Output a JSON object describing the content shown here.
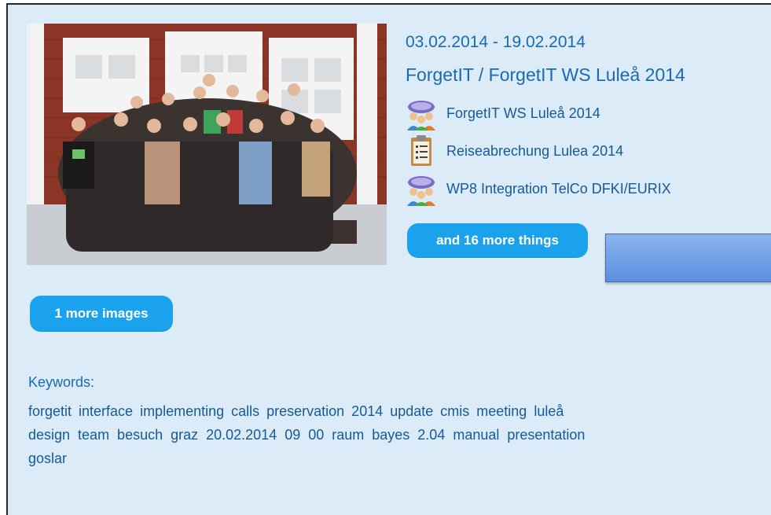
{
  "event": {
    "date_range": "03.02.2014 - 19.02.2014",
    "breadcrumb": "ForgetIT / ForgetIT WS Luleå 2014"
  },
  "things": [
    {
      "label": "ForgetIT WS Luleå 2014",
      "icon": "people-meeting-icon"
    },
    {
      "label": "Reiseabrechung Lulea 2014",
      "icon": "clipboard-document-icon"
    },
    {
      "label": "WP8 Integration TelCo DFKI/EURIX",
      "icon": "people-meeting-icon"
    }
  ],
  "buttons": {
    "more_things": "and 16 more things",
    "more_images": "1 more images"
  },
  "keywords": {
    "label": "Keywords:",
    "lines": [
      "forgetit interface implementing calls preservation 2014 update cmis meeting luleå",
      "design team besuch graz 20.02.2014 09 00 raum bayes 2.04 manual presentation",
      "goslar"
    ]
  },
  "colors": {
    "card_bg": "#dcebf8",
    "accent": "#1aa3ec",
    "link_text": "#1a6ab0"
  }
}
